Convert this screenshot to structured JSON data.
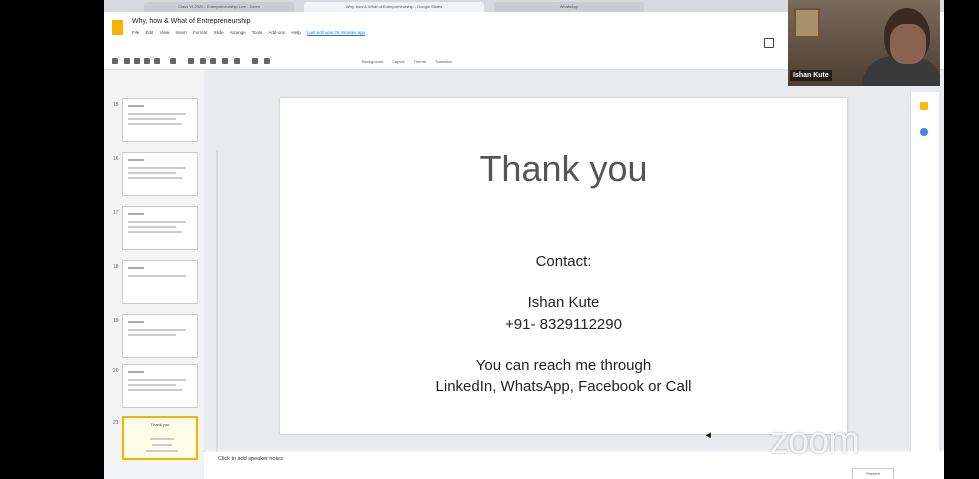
{
  "browser": {
    "tabs": [
      {
        "label": "Class VI-2020 - Entrepreneurship Live - Zoom"
      },
      {
        "label": "Why, how & What of Entrepreneurship - Google Slides"
      },
      {
        "label": "WhatsApp"
      }
    ]
  },
  "slides_app": {
    "doc_title": "Why, how & What of Entrepreneurship",
    "menu": [
      "File",
      "Edit",
      "View",
      "Insert",
      "Format",
      "Slide",
      "Arrange",
      "Tools",
      "Add-ons",
      "Help"
    ],
    "last_edit": "Last edit was 26 minutes ago",
    "toolbar_labels": [
      "Background",
      "Layout",
      "Theme",
      "Transition"
    ],
    "speaker_notes_placeholder": "Click to add speaker notes",
    "present_label": "Present"
  },
  "filmstrip": {
    "slides": [
      {
        "number": "15"
      },
      {
        "number": "16"
      },
      {
        "number": "17"
      },
      {
        "number": "18"
      },
      {
        "number": "19"
      },
      {
        "number": "20"
      },
      {
        "number": "21",
        "title": "Thank you",
        "selected": true
      }
    ]
  },
  "slide": {
    "title": "Thank you",
    "contact_label": "Contact:",
    "name": "Ishan Kute",
    "phone": "+91- 8329112290",
    "reach_line1": "You can reach me through",
    "reach_line2": "LinkedIn, WhatsApp, Facebook or Call"
  },
  "webcam": {
    "participant_name": "Ishan Kute"
  },
  "watermark": "zoom",
  "colors": {
    "slides_accent": "#f4b400",
    "link_blue": "#1a73e8"
  }
}
